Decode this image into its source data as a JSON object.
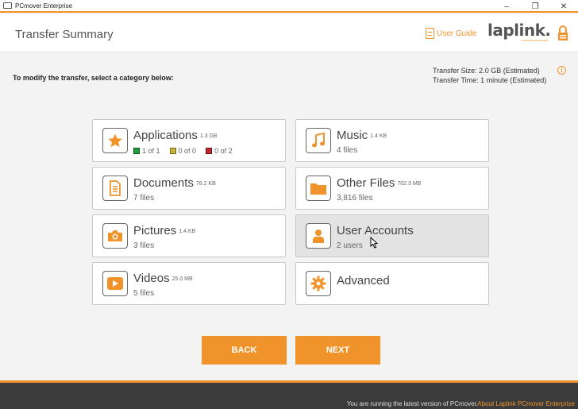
{
  "window": {
    "title": "PCmover Enterprise",
    "minimize": "–",
    "restore": "❐",
    "close": "✕"
  },
  "header": {
    "page_title": "Transfer Summary",
    "user_guide": "User Guide",
    "logo": "laplink.",
    "logo_tagline": "connect your world"
  },
  "summary": {
    "instructions": "To modify the transfer, select a category below:",
    "transfer_size": "Transfer Size: 2.0 GB (Estimated)",
    "transfer_time": "Transfer Time: 1 minute (Estimated)",
    "info": "i"
  },
  "categories": {
    "applications": {
      "name": "Applications",
      "size": "1.3 GB",
      "green": "1 of 1",
      "yellow": "0 of 0",
      "red": "0 of 2"
    },
    "music": {
      "name": "Music",
      "size": "1.4 KB",
      "sub": "4 files"
    },
    "documents": {
      "name": "Documents",
      "size": "78.2 KB",
      "sub": "7 files"
    },
    "other_files": {
      "name": "Other Files",
      "size": "702.3 MB",
      "sub": "3,816 files"
    },
    "pictures": {
      "name": "Pictures",
      "size": "1.4 KB",
      "sub": "3 files"
    },
    "user_accounts": {
      "name": "User Accounts",
      "sub": "2 users"
    },
    "videos": {
      "name": "Videos",
      "size": "25.0 MB",
      "sub": "5 files"
    },
    "advanced": {
      "name": "Advanced"
    }
  },
  "buttons": {
    "back": "BACK",
    "next": "NEXT"
  },
  "footer": {
    "message": "You are running the latest version of PCmover.",
    "about": "About Laplink PCmover Enterprise"
  },
  "colors": {
    "accent": "#f0932b",
    "green": "#1f9d3a",
    "yellow": "#c9b33b",
    "red": "#c0282d"
  }
}
